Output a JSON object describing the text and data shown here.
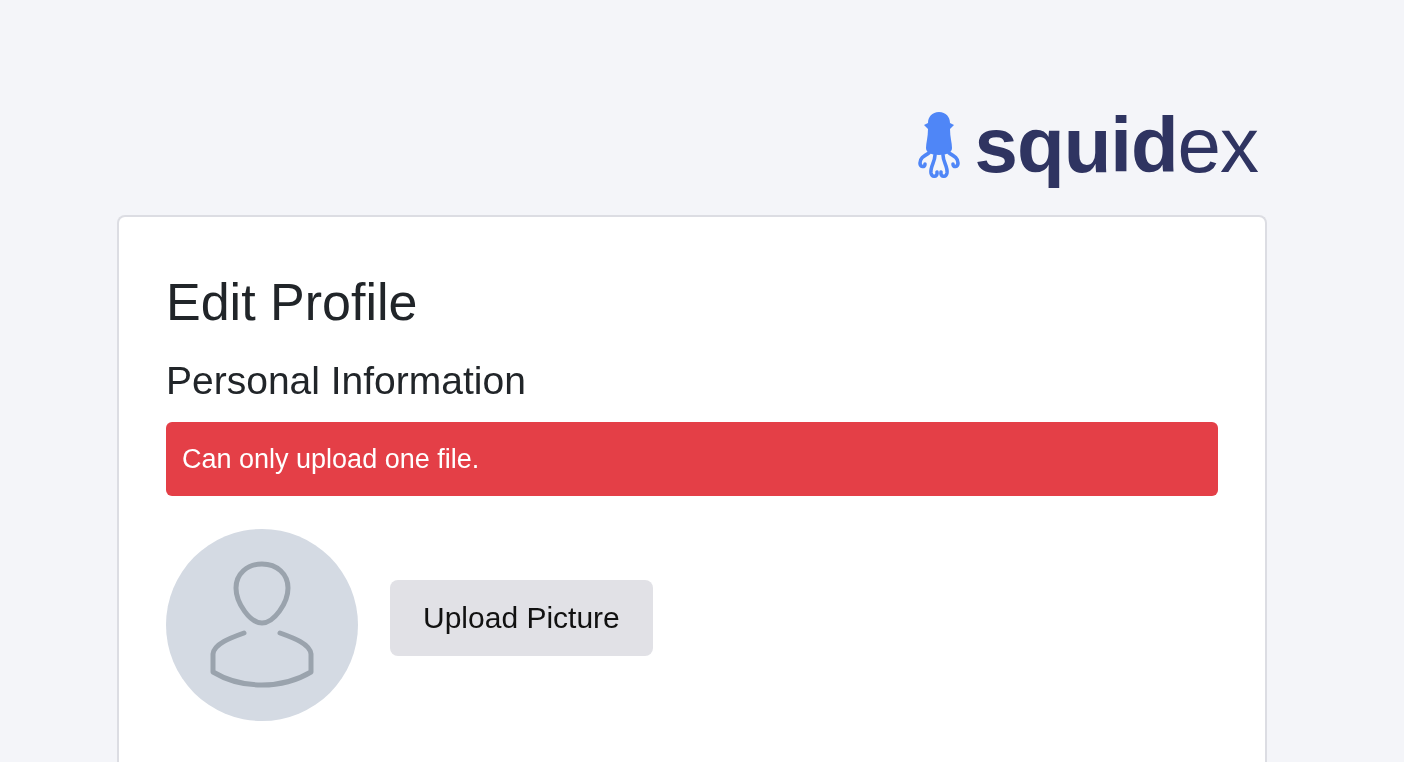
{
  "logo": {
    "wordmark": "**squid**ex"
  },
  "card": {
    "title": "Edit Profile",
    "section_title": "Personal Information",
    "alert": {
      "kind": "error",
      "message": "Can only upload one file."
    },
    "upload_button": {
      "label": "Upload Picture"
    }
  }
}
